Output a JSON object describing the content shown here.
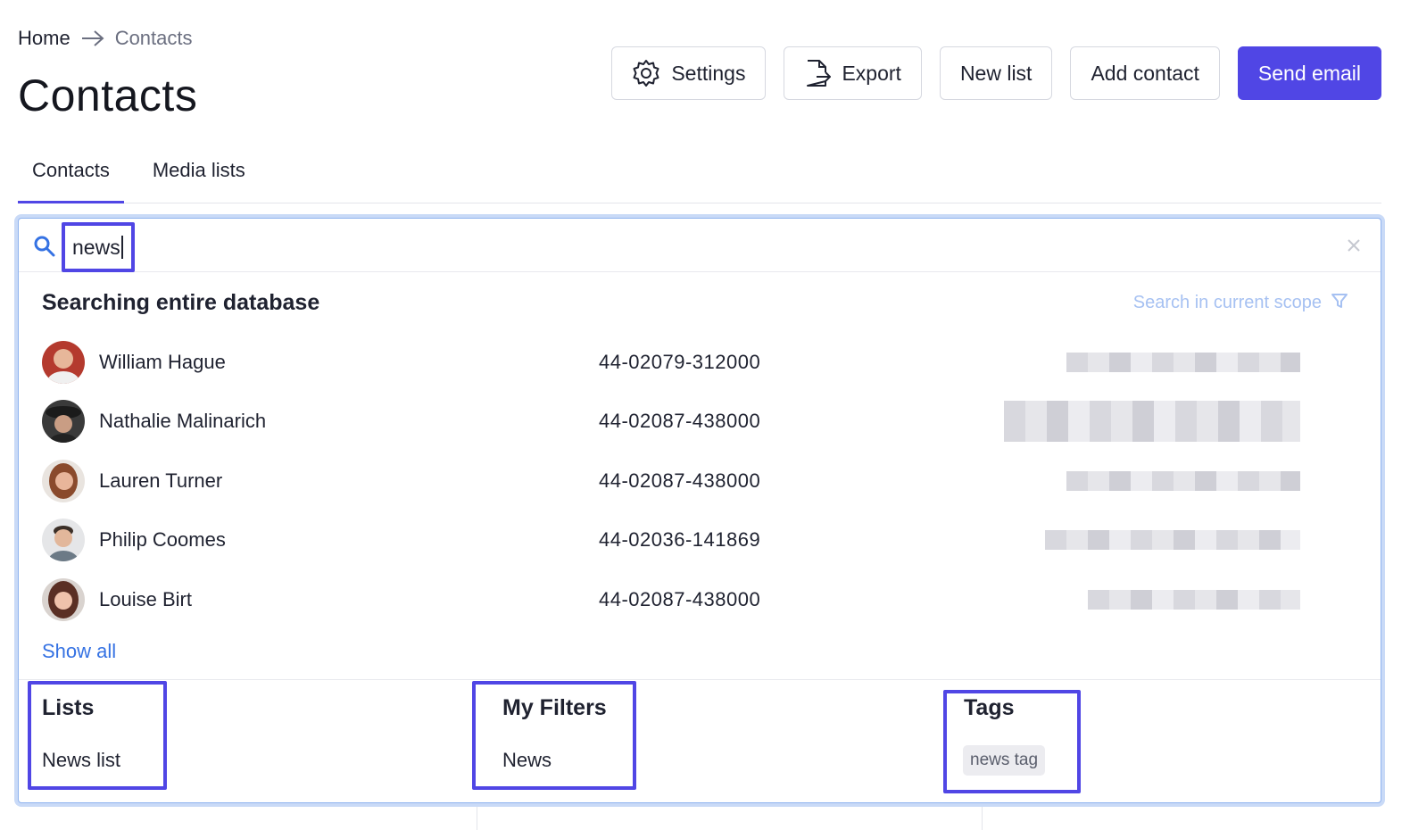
{
  "breadcrumb": {
    "home": "Home",
    "current": "Contacts"
  },
  "page": {
    "title": "Contacts"
  },
  "toolbar": {
    "settings_label": "Settings",
    "export_label": "Export",
    "new_list_label": "New list",
    "add_contact_label": "Add contact",
    "send_email_label": "Send email"
  },
  "tabs": [
    {
      "label": "Contacts",
      "active": true
    },
    {
      "label": "Media lists",
      "active": false
    }
  ],
  "search": {
    "value": "news",
    "results_title": "Searching entire database",
    "scope_link": "Search in current scope",
    "show_all": "Show all"
  },
  "contacts": [
    {
      "name": "William Hague",
      "phone": "44-02079-312000"
    },
    {
      "name": "Nathalie Malinarich",
      "phone": "44-02087-438000"
    },
    {
      "name": "Lauren Turner",
      "phone": "44-02087-438000"
    },
    {
      "name": "Philip Coomes",
      "phone": "44-02036-141869"
    },
    {
      "name": "Louise Birt",
      "phone": "44-02087-438000"
    }
  ],
  "groups": {
    "lists": {
      "title": "Lists",
      "item": "News list"
    },
    "filters": {
      "title": "My Filters",
      "item": "News"
    },
    "tags": {
      "title": "Tags",
      "item": "news tag"
    }
  },
  "colors": {
    "primary": "#5046e5",
    "link": "#3572e3",
    "scope_link": "#a6c1f2"
  },
  "icons": {
    "settings": "gear-icon",
    "export": "export-file-icon",
    "search": "search-icon",
    "clear": "close-icon",
    "scope": "filter-icon",
    "breadcrumb_sep": "arrow-right-icon"
  }
}
